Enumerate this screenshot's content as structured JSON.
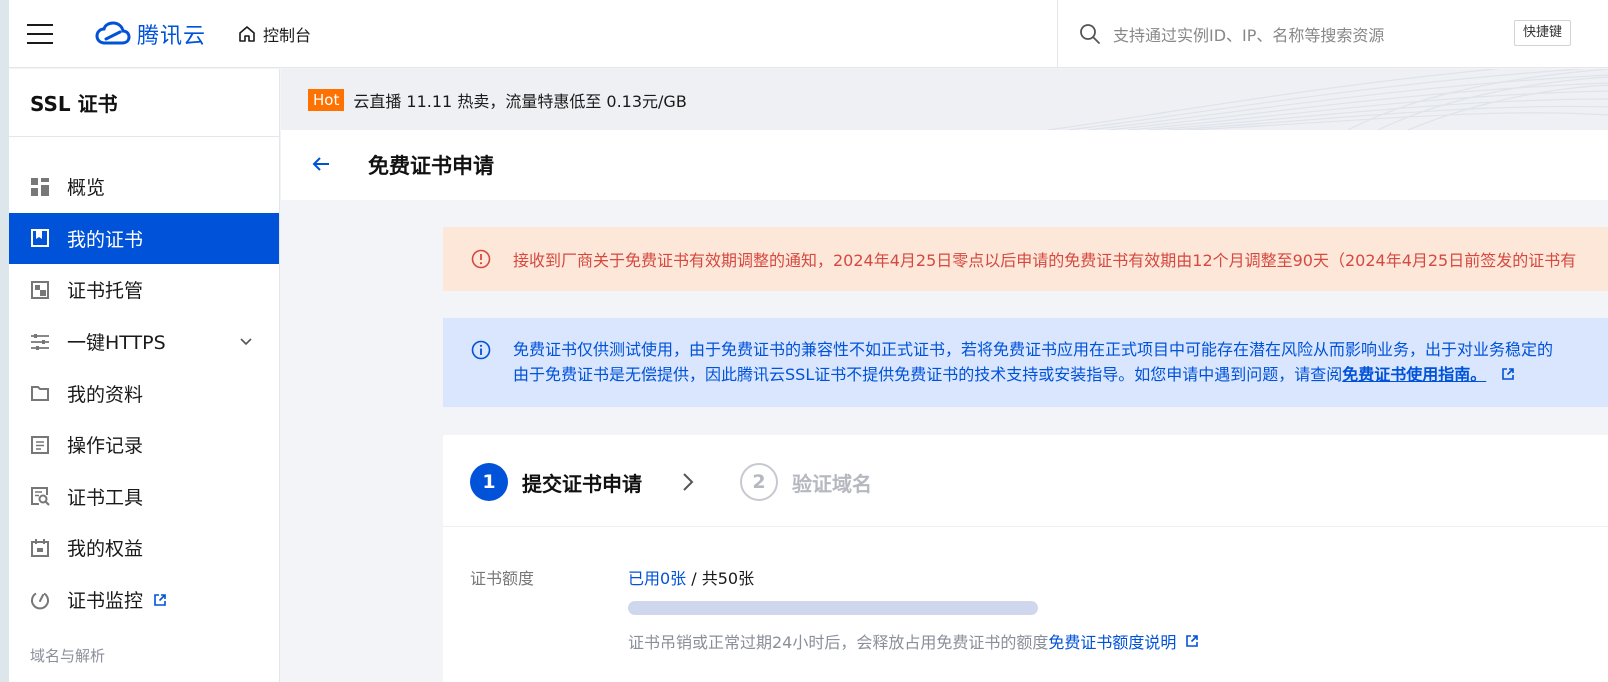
{
  "topbar": {
    "brand": "腾讯云",
    "console_label": "控制台",
    "search_placeholder": "支持通过实例ID、IP、名称等搜索资源",
    "shortcut_label": "快捷键"
  },
  "sidebar": {
    "title": "SSL 证书",
    "items": [
      {
        "label": "概览",
        "icon": "dashboard-icon"
      },
      {
        "label": "我的证书",
        "icon": "certificate-icon",
        "active": true
      },
      {
        "label": "证书托管",
        "icon": "hosting-icon"
      },
      {
        "label": "一键HTTPS",
        "icon": "sliders-icon"
      },
      {
        "label": "我的资料",
        "icon": "folder-icon"
      },
      {
        "label": "操作记录",
        "icon": "log-icon"
      },
      {
        "label": "证书工具",
        "icon": "tool-icon"
      },
      {
        "label": "我的权益",
        "icon": "calendar-icon"
      },
      {
        "label": "证书监控",
        "icon": "monitor-icon"
      }
    ],
    "section_label": "域名与解析"
  },
  "promo": {
    "badge": "Hot",
    "text": "云直播 11.11 热卖，流量特惠低至 0.13元/GB"
  },
  "page": {
    "title": "免费证书申请"
  },
  "notices": {
    "warning": "接收到厂商关于免费证书有效期调整的通知，2024年4月25日零点以后申请的免费证书有效期由12个月调整至90天（2024年4月25日前签发的证书有",
    "info_line1": "免费证书仅供测试使用，由于免费证书的兼容性不如正式证书，若将免费证书应用在正式项目中可能存在潜在风险从而影响业务，出于对业务稳定的",
    "info_line2": "由于免费证书是无偿提供，因此腾讯云SSL证书不提供免费证书的技术支持或安装指导。如您申请中遇到问题，请查阅",
    "info_link": "免费证书使用指南。"
  },
  "steps": [
    {
      "number": "1",
      "label": "提交证书申请"
    },
    {
      "number": "2",
      "label": "验证域名"
    }
  ],
  "quota": {
    "label": "证书额度",
    "used": "已用0张",
    "total": " / 共50张",
    "progress_fraction": 0,
    "note": "证书吊销或正常过期24小时后，会释放占用免费证书的额度",
    "note_link": "免费证书额度说明"
  },
  "colors": {
    "brand": "#0052d9",
    "hot": "#ff7200",
    "warning_text": "#d54941",
    "warning_bg": "#fde7d8",
    "info_bg": "#d9e6fd"
  }
}
